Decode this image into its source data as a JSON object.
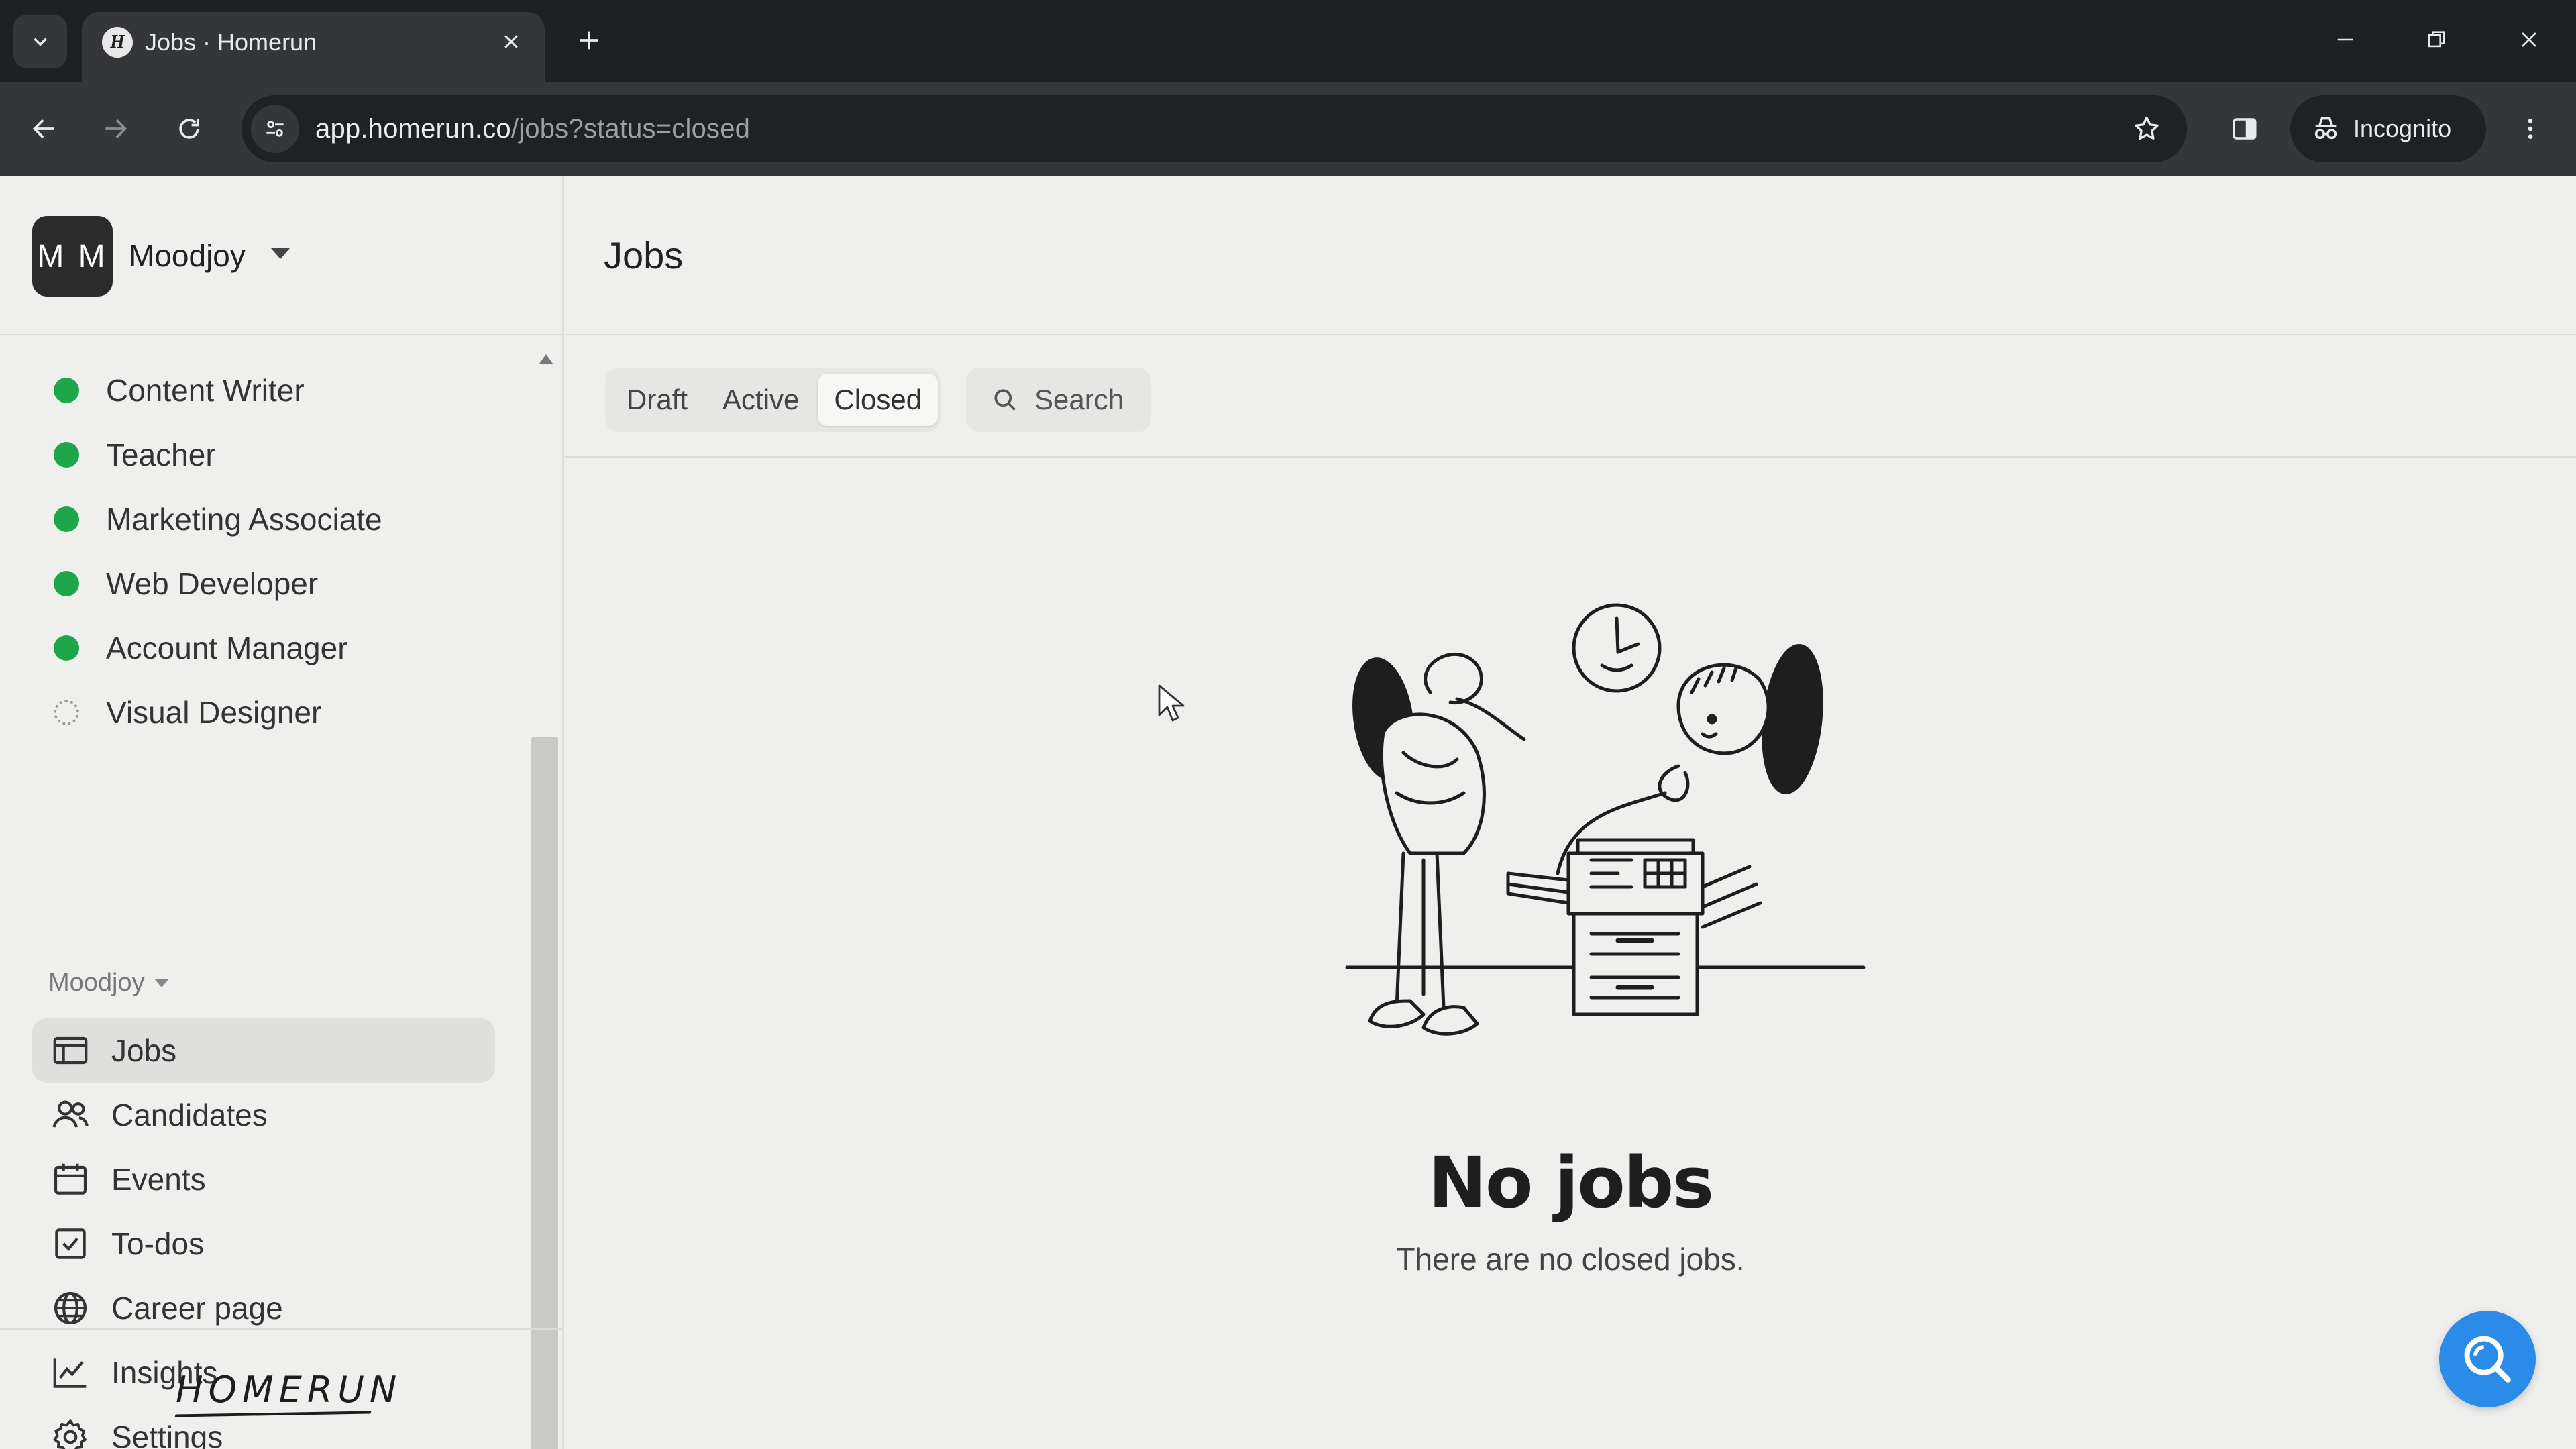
{
  "browser": {
    "tab_title": "Jobs · Homerun",
    "favicon_letter": "H",
    "url_host": "app.homerun.co",
    "url_path": "/jobs?status=closed",
    "incognito_label": "Incognito"
  },
  "sidebar": {
    "avatar_initials": "M M",
    "workspace_name": "Moodjoy",
    "jobs": [
      {
        "label": "Content Writer",
        "status": "active"
      },
      {
        "label": "Teacher",
        "status": "active"
      },
      {
        "label": "Marketing Associate",
        "status": "active"
      },
      {
        "label": "Web Developer",
        "status": "active"
      },
      {
        "label": "Account Manager",
        "status": "active"
      },
      {
        "label": "Visual Designer",
        "status": "draft"
      }
    ],
    "section_label": "Moodjoy",
    "nav": [
      {
        "label": "Jobs",
        "icon": "jobs-icon"
      },
      {
        "label": "Candidates",
        "icon": "candidates-icon"
      },
      {
        "label": "Events",
        "icon": "calendar-icon"
      },
      {
        "label": "To-dos",
        "icon": "checkbox-icon"
      },
      {
        "label": "Career page",
        "icon": "globe-icon"
      },
      {
        "label": "Insights",
        "icon": "chart-line-icon"
      },
      {
        "label": "Settings",
        "icon": "gear-icon"
      }
    ],
    "logo_text": "HOMERUN"
  },
  "main": {
    "title": "Jobs",
    "filters": [
      "Draft",
      "Active",
      "Closed"
    ],
    "selected_filter": "Closed",
    "search_label": "Search",
    "empty_title": "No jobs",
    "empty_subtitle": "There are no closed jobs."
  },
  "colors": {
    "active_dot": "#1fa64a",
    "help_button": "#2a8be8",
    "browser_frame": "#1f2022"
  }
}
